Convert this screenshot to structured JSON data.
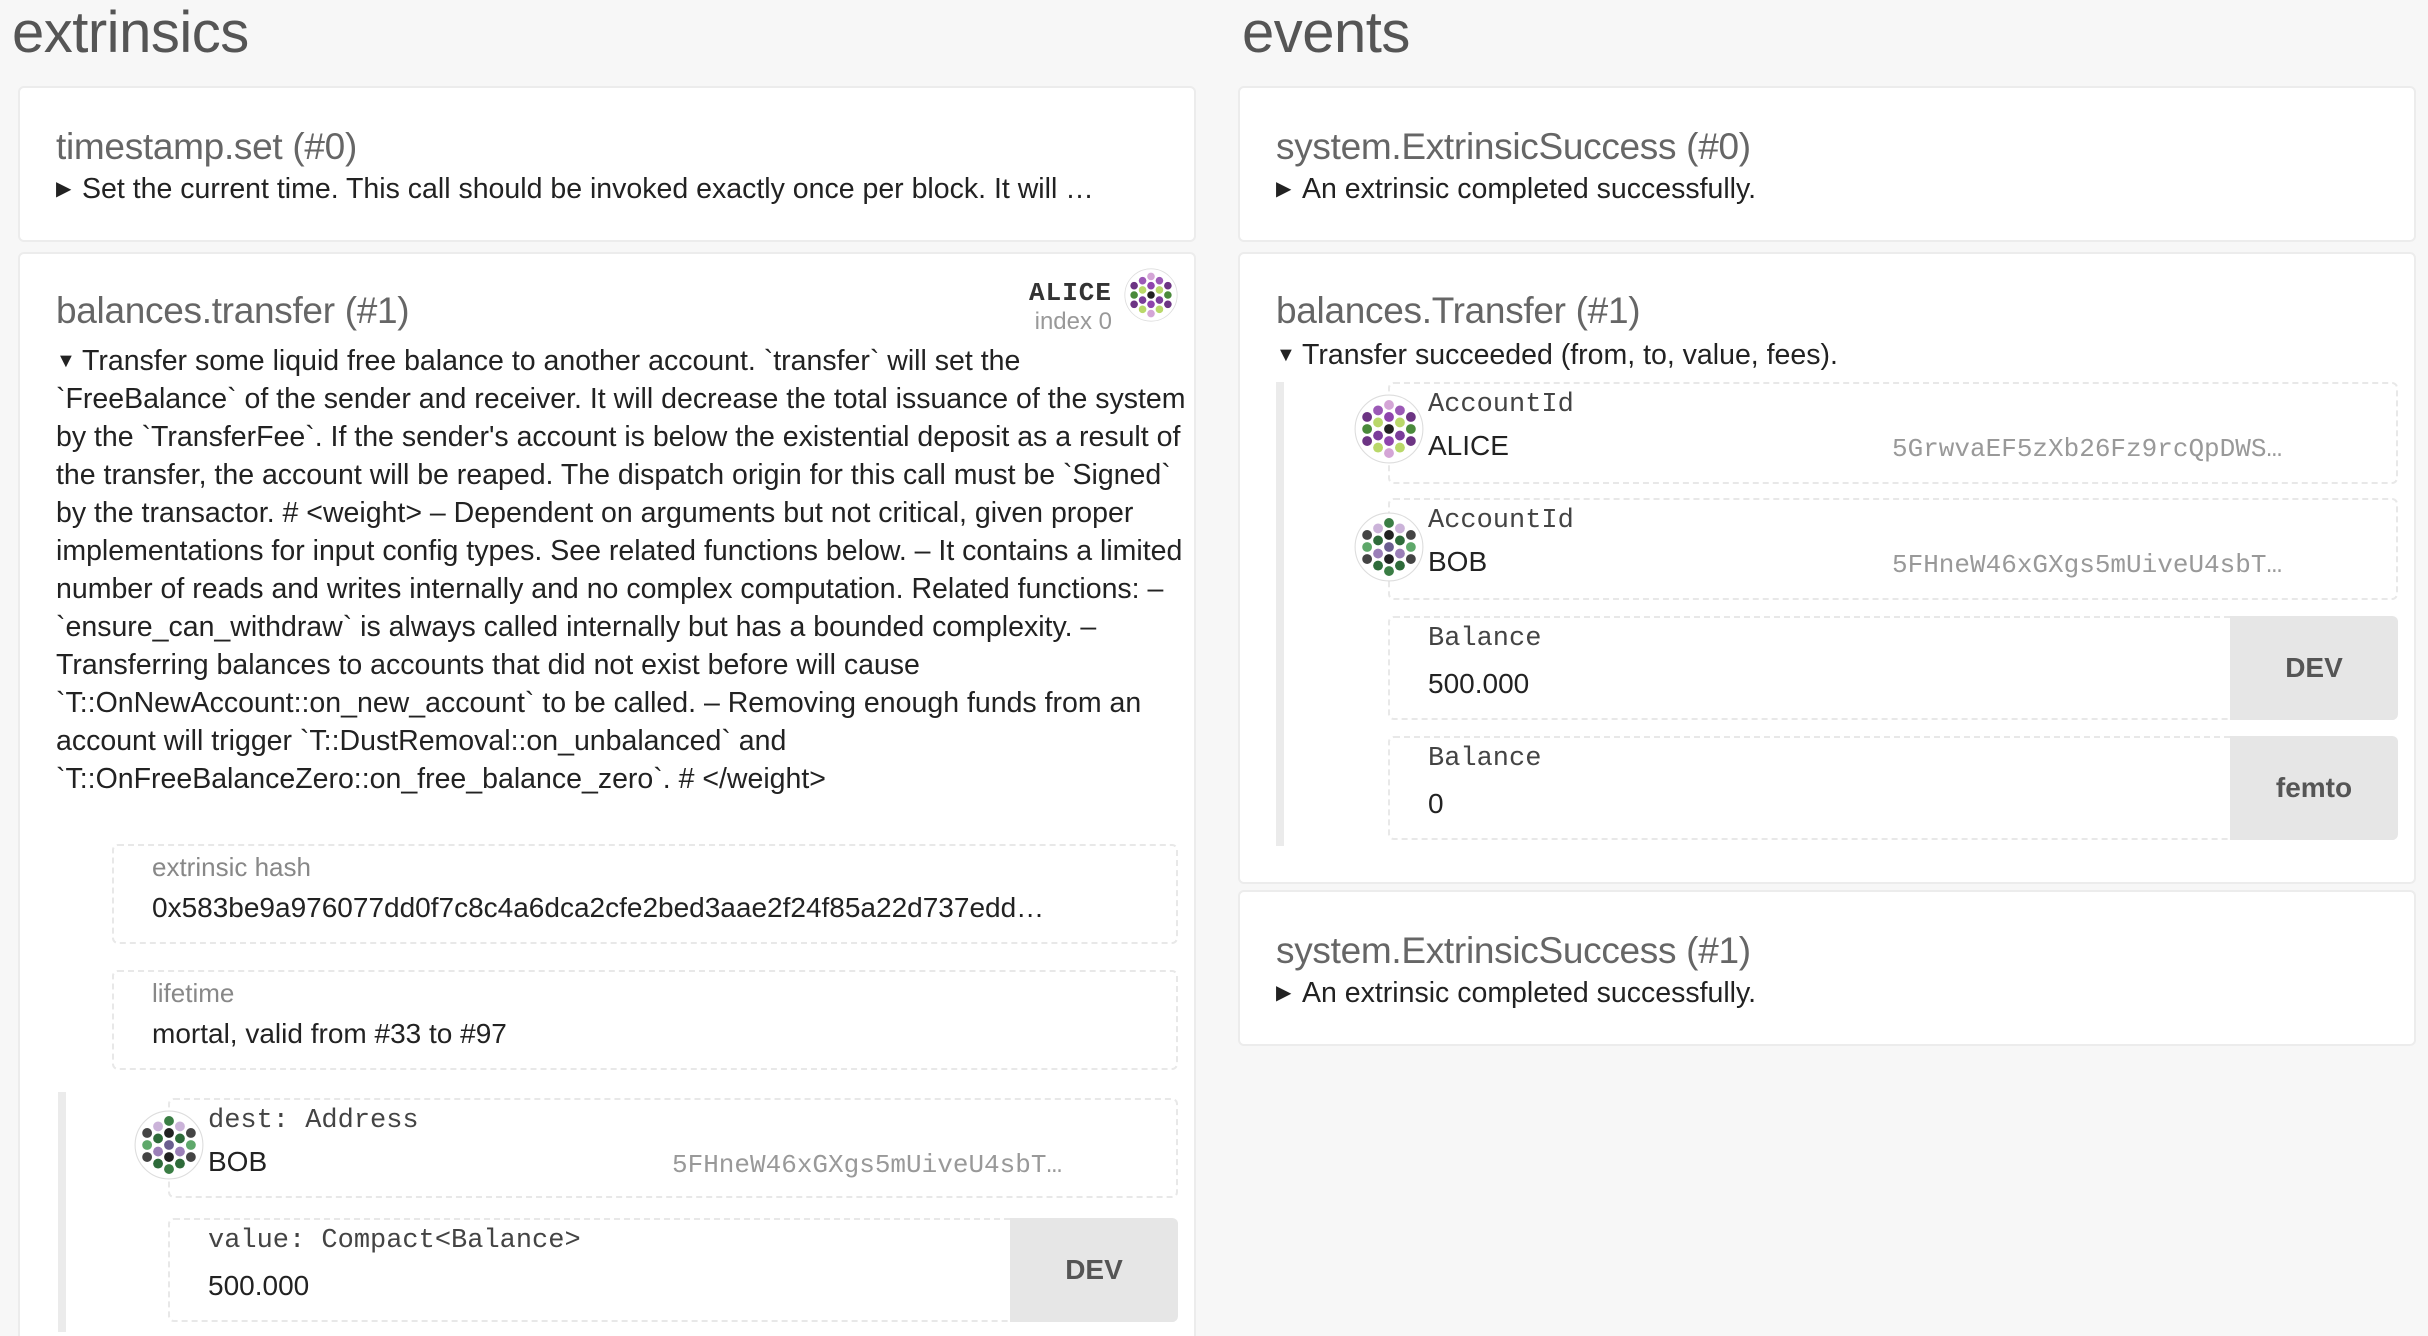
{
  "extrinsics": {
    "title": "extrinsics",
    "items": [
      {
        "title": "timestamp.set (#0)",
        "collapsed": true,
        "description": "Set the current time. This call should be invoked exactly once per block. It will …"
      },
      {
        "title": "balances.transfer (#1)",
        "collapsed": false,
        "signer": {
          "name": "ALICE",
          "index": "index 0"
        },
        "description": "Transfer some liquid free balance to another account. `transfer` will set the `FreeBalance` of the sender and receiver. It will decrease the total issuance of the system by the `TransferFee`. If the sender's account is below the existential deposit as a result of the transfer, the account will be reaped. The dispatch origin for this call must be `Signed` by the transactor. # <weight> – Dependent on arguments but not critical, given proper implementations for input config types. See related functions below. – It contains a limited number of reads and writes internally and no complex computation. Related functions: – `ensure_can_withdraw` is always called internally but has a bounded complexity. – Transferring balances to accounts that did not exist before will cause `T::OnNewAccount::on_new_account` to be called. – Removing enough funds from an account will trigger `T::DustRemoval::on_unbalanced` and `T::OnFreeBalanceZero::on_free_balance_zero`. # </weight>",
        "extrinsic_hash": {
          "label": "extrinsic hash",
          "value": "0x583be9a976077dd0f7c8c4a6dca2cfe2bed3aae2f24f85a22d737edd…"
        },
        "lifetime": {
          "label": "lifetime",
          "value": "mortal, valid from #33 to #97"
        },
        "params": {
          "dest": {
            "label": "dest: Address",
            "name": "BOB",
            "address": "5FHneW46xGXgs5mUiveU4sbT…"
          },
          "value": {
            "label": "value: Compact<Balance>",
            "value": "500.000",
            "unit": "DEV"
          }
        }
      }
    ]
  },
  "events": {
    "title": "events",
    "items": [
      {
        "title": "system.ExtrinsicSuccess (#0)",
        "collapsed": true,
        "description": "An extrinsic completed successfully."
      },
      {
        "title": "balances.Transfer (#1)",
        "collapsed": false,
        "description": "Transfer succeeded (from, to, value, fees).",
        "params": [
          {
            "label": "AccountId",
            "name": "ALICE",
            "address": "5GrwvaEF5zXb26Fz9rcQpDWS…"
          },
          {
            "label": "AccountId",
            "name": "BOB",
            "address": "5FHneW46xGXgs5mUiveU4sbT…"
          },
          {
            "label": "Balance",
            "value": "500.000",
            "unit": "DEV"
          },
          {
            "label": "Balance",
            "value": "0",
            "unit": "femto"
          }
        ]
      },
      {
        "title": "system.ExtrinsicSuccess (#1)",
        "collapsed": true,
        "description": "An extrinsic completed successfully."
      }
    ]
  },
  "icons": {
    "triangle_right": "▶",
    "triangle_down": "▼",
    "identicon": "polkadot-identicon"
  },
  "colors": {
    "background": "#f7f7f7",
    "card": "#ffffff",
    "unit_button": "#e6e6e6"
  }
}
